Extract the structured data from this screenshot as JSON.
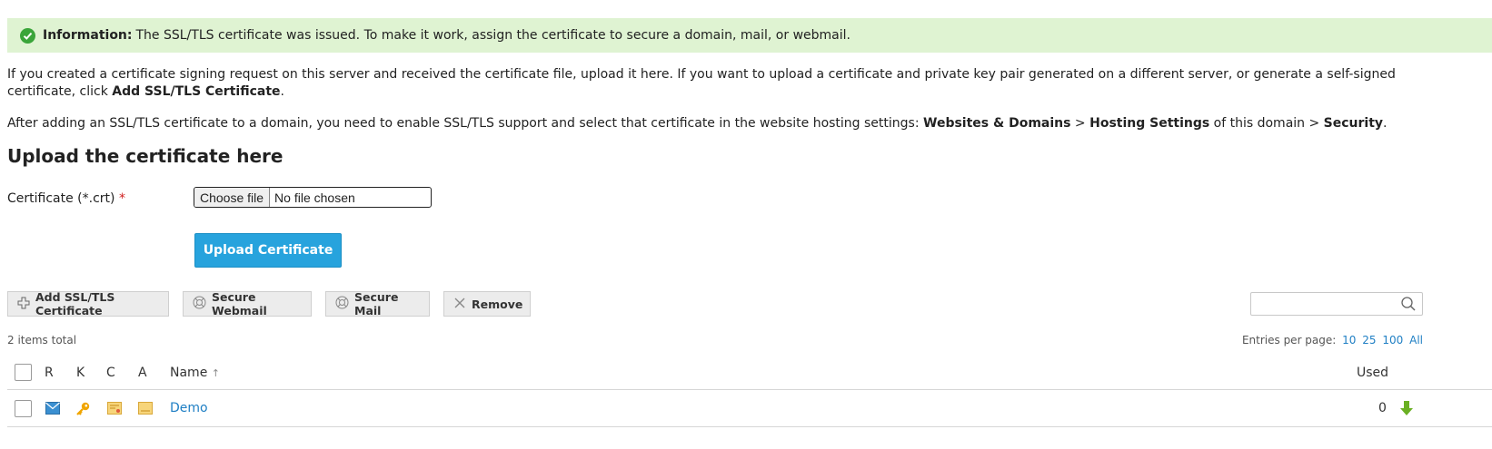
{
  "notice": {
    "title": "Information:",
    "message": "The SSL/TLS certificate was issued. To make it work, assign the certificate to secure a domain, mail, or webmail.",
    "color": "#dff3d2"
  },
  "intro": {
    "text": "If you created a certificate signing request on this server and received the certificate file, upload it here. If you want to upload a certificate and private key pair generated on a different server, or generate a self-signed certificate, click ",
    "bold_action": "Add SSL/TLS Certificate",
    "end": "."
  },
  "hint": {
    "prefix": "After adding an SSL/TLS certificate to a domain, you need to enable SSL/TLS support and select that certificate in the website hosting settings: ",
    "path1": "Websites & Domains",
    "sep1": " > ",
    "path2": "Hosting Settings",
    "middle": " of this domain > ",
    "path3": "Security",
    "end": "."
  },
  "upload_section": {
    "heading": "Upload the certificate here",
    "field_label": "Certificate (*.crt)",
    "required_mark": "*",
    "choose_file_label": "Choose file",
    "no_file_text": "No file chosen",
    "submit_label": "Upload Certificate"
  },
  "toolbar": {
    "add_label": "Add SSL/TLS Certificate",
    "webmail_label": "Secure Webmail",
    "mail_label": "Secure Mail",
    "remove_label": "Remove",
    "search_value": ""
  },
  "list": {
    "total_text": "2 items total",
    "entries_label": "Entries per page:",
    "entries_options": [
      "10",
      "25",
      "100",
      "All"
    ],
    "columns": {
      "r": "R",
      "k": "K",
      "c": "C",
      "a": "A",
      "name": "Name",
      "name_sort": "↑",
      "used": "Used"
    },
    "rows": [
      {
        "name": "Demo",
        "used": "0"
      }
    ]
  },
  "colors": {
    "accent": "#27a3dd",
    "link": "#1f7fc4",
    "success": "#3aa53a",
    "download": "#6ab023"
  }
}
